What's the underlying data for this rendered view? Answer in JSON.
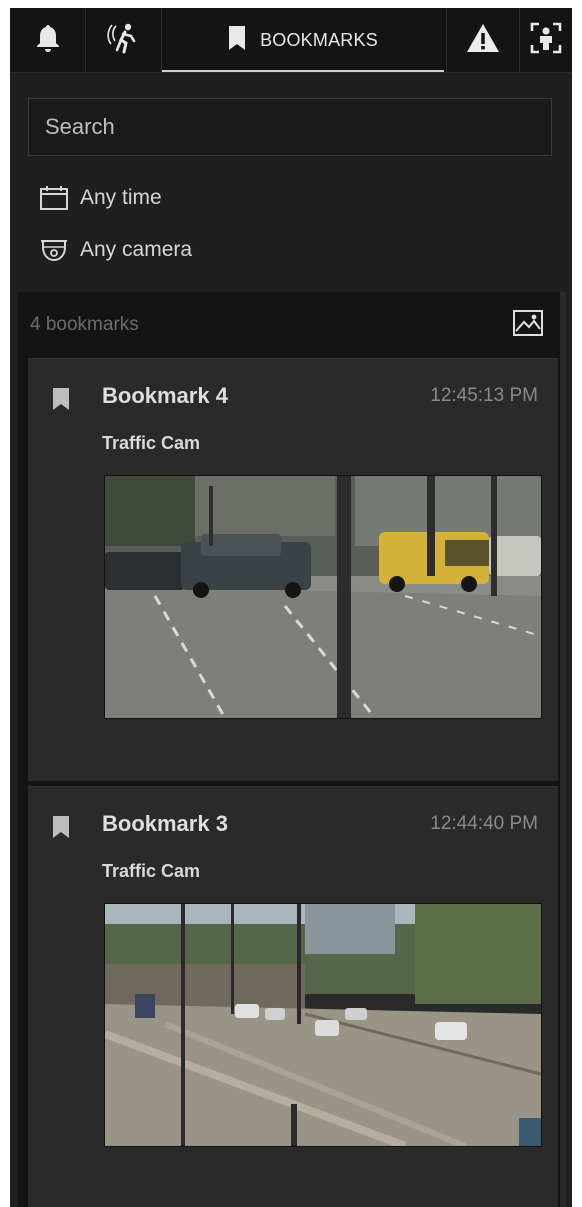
{
  "tabs": [
    {
      "name": "notifications",
      "icon": "bell-icon",
      "label": ""
    },
    {
      "name": "motion",
      "icon": "motion-person-icon",
      "label": ""
    },
    {
      "name": "bookmarks",
      "icon": "bookmark-icon",
      "label": "BOOKMARKS",
      "active": true
    },
    {
      "name": "alarms",
      "icon": "warning-icon",
      "label": ""
    },
    {
      "name": "people",
      "icon": "person-frame-icon",
      "label": ""
    }
  ],
  "search": {
    "placeholder": "Search",
    "value": ""
  },
  "filters": {
    "time": {
      "icon": "calendar-icon",
      "label": "Any time"
    },
    "camera": {
      "icon": "dome-camera-icon",
      "label": "Any camera"
    }
  },
  "list": {
    "count_label": "4 bookmarks",
    "gallery_icon": "image-gallery-icon",
    "bookmarks": [
      {
        "title": "Bookmark 4",
        "time": "12:45:13 PM",
        "camera": "Traffic Cam",
        "thumbnail": "traffic-intersection-thumbnail"
      },
      {
        "title": "Bookmark 3",
        "time": "12:44:40 PM",
        "camera": "Traffic Cam",
        "thumbnail": "traffic-highway-thumbnail"
      }
    ]
  },
  "colors": {
    "panel_bg": "#1f1f1f",
    "card_bg": "#2a2a2a",
    "list_bg": "#141414",
    "tab_bg": "#141414",
    "text_primary": "#dedede",
    "text_muted": "#8a8a8a"
  }
}
